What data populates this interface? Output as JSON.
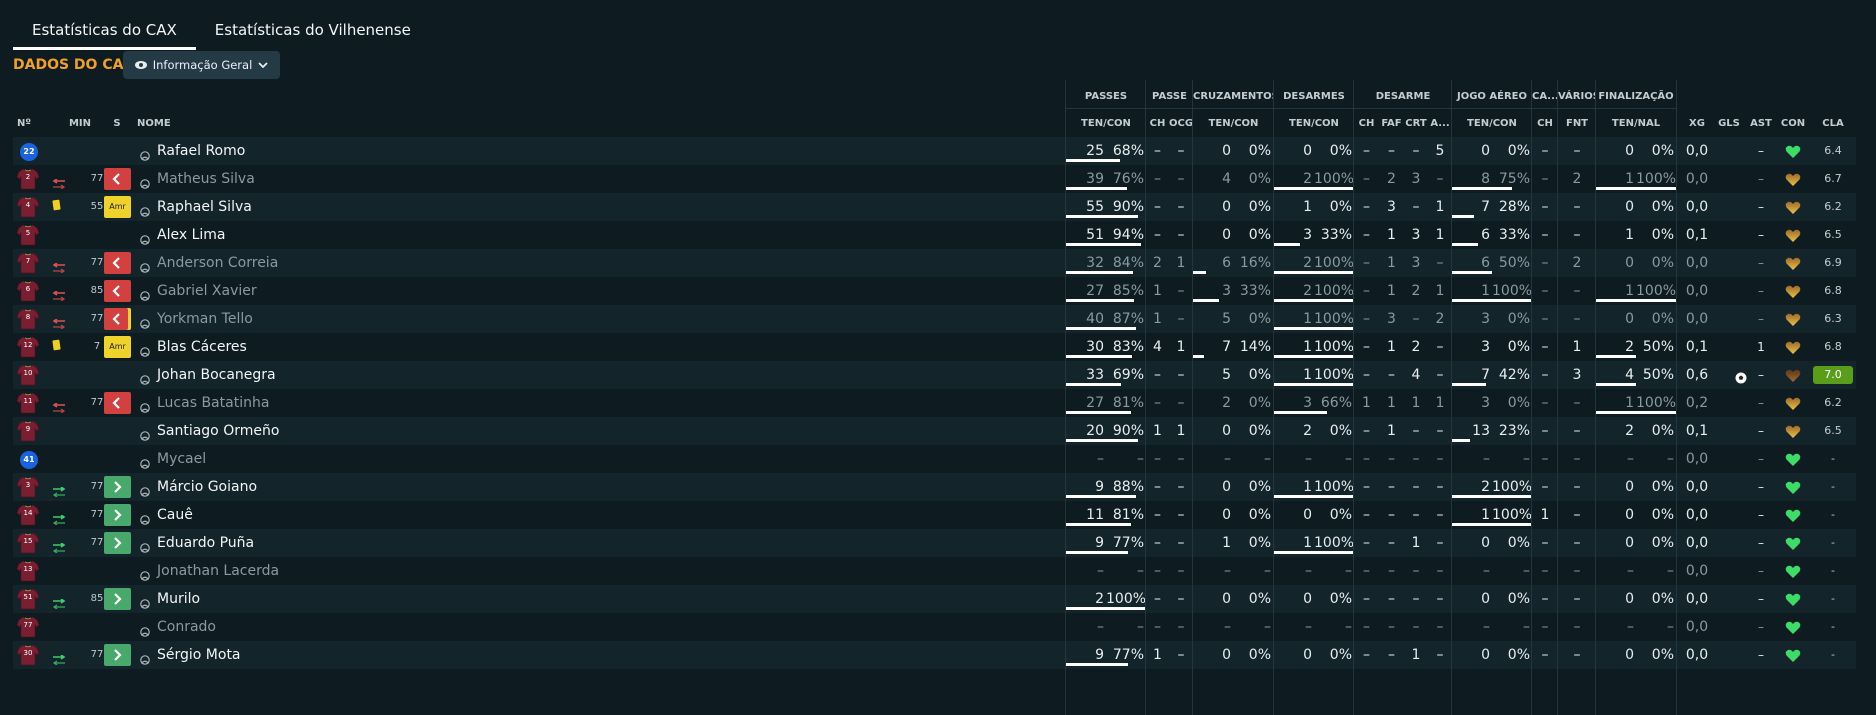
{
  "tabs": [
    {
      "label": "Estatísticas do CAX",
      "active": true
    },
    {
      "label": "Estatísticas do Vilhenense",
      "active": false
    }
  ],
  "section_title": "DADOS DO CAX",
  "view_selector": {
    "label": "Informação Geral",
    "icon": "eye-icon"
  },
  "colors": {
    "accent": "#f0a025",
    "green": "#49a86b",
    "red": "#d24040",
    "yellow": "#efd22a",
    "best_rating": "#5a9d1a"
  },
  "group_headers": {
    "passes": "PASSES",
    "passe": "PASSE",
    "cruzamentos": "CRUZAMENTOS",
    "desarmes": "DESARMES",
    "desarme": "DESARME",
    "jogo_aereo": "JOGO AÉREO",
    "ca": "CA...",
    "varios": "VÁRIOS",
    "finalizacao": "FINALIZAÇÃO"
  },
  "column_headers": {
    "num": "Nº",
    "min": "MIN",
    "s": "S",
    "nome": "NOME",
    "passes": "TEN/CON",
    "passe_ch": "CH",
    "passe_ocg": "OCG",
    "cruz": "TEN/CON",
    "des": "TEN/CON",
    "d_ch": "CH",
    "d_faf": "FAF",
    "d_crt": "CRT",
    "d_a": "A...",
    "aereo": "TEN/CON",
    "ca_ch": "CH",
    "fnt": "FNT",
    "fin": "TEN/NAL",
    "xg": "XG",
    "gls": "GLS",
    "ast": "AST",
    "con": "CON",
    "cla": "CLA"
  },
  "players": [
    {
      "num": "22",
      "kit": "gk",
      "min": "",
      "sub": "",
      "card": "",
      "s": "",
      "name": "Rafael Romo",
      "dim": false,
      "p_ten": "25",
      "p_pct": "68%",
      "p_bar": 0.68,
      "pch": "–",
      "pocg": "–",
      "c_ten": "0",
      "c_pct": "0%",
      "c_bar": 0,
      "d_ten": "0",
      "d_pct": "0%",
      "d_bar": 0,
      "dch": "–",
      "dfaf": "–",
      "dcrt": "–",
      "da": "5",
      "a_ten": "0",
      "a_pct": "0%",
      "a_bar": 0,
      "cach": "–",
      "fnt": "–",
      "f_ten": "0",
      "f_pct": "0%",
      "f_bar": 0,
      "xg": "0,0",
      "gls": "",
      "ast": "–",
      "con": "green",
      "cla": "6.4",
      "best": false
    },
    {
      "num": "2",
      "kit": "out",
      "min": "77",
      "sub": "out",
      "card": "",
      "s": "red",
      "name": "Matheus Silva",
      "dim": true,
      "p_ten": "39",
      "p_pct": "76%",
      "p_bar": 0.76,
      "pch": "–",
      "pocg": "–",
      "c_ten": "4",
      "c_pct": "0%",
      "c_bar": 0,
      "d_ten": "2",
      "d_pct": "100%",
      "d_bar": 1,
      "dch": "–",
      "dfaf": "2",
      "dcrt": "3",
      "da": "–",
      "a_ten": "8",
      "a_pct": "75%",
      "a_bar": 0.75,
      "cach": "–",
      "fnt": "2",
      "f_ten": "1",
      "f_pct": "100%",
      "f_bar": 1,
      "xg": "0,0",
      "gls": "",
      "ast": "–",
      "con": "yellow",
      "cla": "6.7",
      "best": false
    },
    {
      "num": "4",
      "kit": "out",
      "min": "55",
      "sub": "",
      "card": "yellow",
      "s": "amr",
      "name": "Raphael Silva",
      "dim": false,
      "p_ten": "55",
      "p_pct": "90%",
      "p_bar": 0.9,
      "pch": "–",
      "pocg": "–",
      "c_ten": "0",
      "c_pct": "0%",
      "c_bar": 0,
      "d_ten": "1",
      "d_pct": "0%",
      "d_bar": 0,
      "dch": "–",
      "dfaf": "3",
      "dcrt": "–",
      "da": "1",
      "a_ten": "7",
      "a_pct": "28%",
      "a_bar": 0.28,
      "cach": "–",
      "fnt": "–",
      "f_ten": "0",
      "f_pct": "0%",
      "f_bar": 0,
      "xg": "0,0",
      "gls": "",
      "ast": "–",
      "con": "yellow",
      "cla": "6.2",
      "best": false
    },
    {
      "num": "5",
      "kit": "out",
      "min": "",
      "sub": "",
      "card": "",
      "s": "",
      "name": "Alex Lima",
      "dim": false,
      "p_ten": "51",
      "p_pct": "94%",
      "p_bar": 0.94,
      "pch": "–",
      "pocg": "–",
      "c_ten": "0",
      "c_pct": "0%",
      "c_bar": 0,
      "d_ten": "3",
      "d_pct": "33%",
      "d_bar": 0.33,
      "dch": "–",
      "dfaf": "1",
      "dcrt": "3",
      "da": "1",
      "a_ten": "6",
      "a_pct": "33%",
      "a_bar": 0.33,
      "cach": "–",
      "fnt": "–",
      "f_ten": "1",
      "f_pct": "0%",
      "f_bar": 0,
      "xg": "0,1",
      "gls": "",
      "ast": "–",
      "con": "yellow",
      "cla": "6.5",
      "best": false
    },
    {
      "num": "7",
      "kit": "out",
      "min": "77",
      "sub": "out",
      "card": "",
      "s": "red",
      "name": "Anderson Correia",
      "dim": true,
      "p_ten": "32",
      "p_pct": "84%",
      "p_bar": 0.84,
      "pch": "2",
      "pocg": "1",
      "c_ten": "6",
      "c_pct": "16%",
      "c_bar": 0.16,
      "d_ten": "2",
      "d_pct": "100%",
      "d_bar": 1,
      "dch": "–",
      "dfaf": "1",
      "dcrt": "3",
      "da": "–",
      "a_ten": "6",
      "a_pct": "50%",
      "a_bar": 0.5,
      "cach": "–",
      "fnt": "2",
      "f_ten": "0",
      "f_pct": "0%",
      "f_bar": 0,
      "xg": "0,0",
      "gls": "",
      "ast": "–",
      "con": "yellow",
      "cla": "6.9",
      "best": false
    },
    {
      "num": "6",
      "kit": "out",
      "min": "85",
      "sub": "out",
      "card": "",
      "s": "red",
      "name": "Gabriel Xavier",
      "dim": true,
      "p_ten": "27",
      "p_pct": "85%",
      "p_bar": 0.85,
      "pch": "1",
      "pocg": "–",
      "c_ten": "3",
      "c_pct": "33%",
      "c_bar": 0.33,
      "d_ten": "2",
      "d_pct": "100%",
      "d_bar": 1,
      "dch": "–",
      "dfaf": "1",
      "dcrt": "2",
      "da": "1",
      "a_ten": "1",
      "a_pct": "100%",
      "a_bar": 1,
      "cach": "–",
      "fnt": "–",
      "f_ten": "1",
      "f_pct": "100%",
      "f_bar": 1,
      "xg": "0,0",
      "gls": "",
      "ast": "–",
      "con": "yellow",
      "cla": "6.8",
      "best": false
    },
    {
      "num": "8",
      "kit": "out",
      "min": "77",
      "sub": "out",
      "card": "yellow",
      "s": "red",
      "name": "Yorkman Tello",
      "dim": true,
      "p_ten": "40",
      "p_pct": "87%",
      "p_bar": 0.87,
      "pch": "1",
      "pocg": "–",
      "c_ten": "5",
      "c_pct": "0%",
      "c_bar": 0,
      "d_ten": "1",
      "d_pct": "100%",
      "d_bar": 1,
      "dch": "–",
      "dfaf": "3",
      "dcrt": "–",
      "da": "2",
      "a_ten": "3",
      "a_pct": "0%",
      "a_bar": 0,
      "cach": "–",
      "fnt": "–",
      "f_ten": "0",
      "f_pct": "0%",
      "f_bar": 0,
      "xg": "0,0",
      "gls": "",
      "ast": "–",
      "con": "yellow",
      "cla": "6.3",
      "best": false
    },
    {
      "num": "12",
      "kit": "out",
      "min": "7",
      "sub": "",
      "card": "yellow",
      "s": "amr",
      "name": "Blas Cáceres",
      "dim": false,
      "p_ten": "30",
      "p_pct": "83%",
      "p_bar": 0.83,
      "pch": "4",
      "pocg": "1",
      "c_ten": "7",
      "c_pct": "14%",
      "c_bar": 0.14,
      "d_ten": "1",
      "d_pct": "100%",
      "d_bar": 1,
      "dch": "–",
      "dfaf": "1",
      "dcrt": "2",
      "da": "–",
      "a_ten": "3",
      "a_pct": "0%",
      "a_bar": 0,
      "cach": "–",
      "fnt": "1",
      "f_ten": "2",
      "f_pct": "50%",
      "f_bar": 0.5,
      "xg": "0,1",
      "gls": "",
      "ast": "1",
      "con": "yellow",
      "cla": "6.8",
      "best": false
    },
    {
      "num": "10",
      "kit": "out",
      "min": "",
      "sub": "",
      "card": "",
      "s": "",
      "name": "Johan Bocanegra",
      "dim": false,
      "p_ten": "33",
      "p_pct": "69%",
      "p_bar": 0.69,
      "pch": "–",
      "pocg": "–",
      "c_ten": "5",
      "c_pct": "0%",
      "c_bar": 0,
      "d_ten": "1",
      "d_pct": "100%",
      "d_bar": 1,
      "dch": "–",
      "dfaf": "–",
      "dcrt": "4",
      "da": "–",
      "a_ten": "7",
      "a_pct": "42%",
      "a_bar": 0.42,
      "cach": "–",
      "fnt": "3",
      "f_ten": "4",
      "f_pct": "50%",
      "f_bar": 0.5,
      "xg": "0,6",
      "gls": "ball",
      "ast": "–",
      "con": "brown",
      "cla": "7.0",
      "best": true
    },
    {
      "num": "11",
      "kit": "out",
      "min": "77",
      "sub": "out",
      "card": "",
      "s": "red",
      "name": "Lucas Batatinha",
      "dim": true,
      "p_ten": "27",
      "p_pct": "81%",
      "p_bar": 0.81,
      "pch": "–",
      "pocg": "–",
      "c_ten": "2",
      "c_pct": "0%",
      "c_bar": 0,
      "d_ten": "3",
      "d_pct": "66%",
      "d_bar": 0.66,
      "dch": "1",
      "dfaf": "1",
      "dcrt": "1",
      "da": "1",
      "a_ten": "3",
      "a_pct": "0%",
      "a_bar": 0,
      "cach": "–",
      "fnt": "–",
      "f_ten": "1",
      "f_pct": "100%",
      "f_bar": 1,
      "xg": "0,2",
      "gls": "",
      "ast": "–",
      "con": "yellow",
      "cla": "6.2",
      "best": false
    },
    {
      "num": "9",
      "kit": "out",
      "min": "",
      "sub": "",
      "card": "",
      "s": "",
      "name": "Santiago Ormeño",
      "dim": false,
      "p_ten": "20",
      "p_pct": "90%",
      "p_bar": 0.9,
      "pch": "1",
      "pocg": "1",
      "c_ten": "0",
      "c_pct": "0%",
      "c_bar": 0,
      "d_ten": "2",
      "d_pct": "0%",
      "d_bar": 0,
      "dch": "–",
      "dfaf": "1",
      "dcrt": "–",
      "da": "–",
      "a_ten": "13",
      "a_pct": "23%",
      "a_bar": 0.23,
      "cach": "–",
      "fnt": "–",
      "f_ten": "2",
      "f_pct": "0%",
      "f_bar": 0,
      "xg": "0,1",
      "gls": "",
      "ast": "–",
      "con": "yellow",
      "cla": "6.5",
      "best": false
    },
    {
      "num": "41",
      "kit": "gk",
      "min": "",
      "sub": "",
      "card": "",
      "s": "",
      "name": "Mycael",
      "dim": true,
      "p_ten": "–",
      "p_pct": "–",
      "p_bar": 0,
      "pch": "–",
      "pocg": "–",
      "c_ten": "–",
      "c_pct": "–",
      "c_bar": 0,
      "d_ten": "–",
      "d_pct": "–",
      "d_bar": 0,
      "dch": "–",
      "dfaf": "–",
      "dcrt": "–",
      "da": "–",
      "a_ten": "–",
      "a_pct": "–",
      "a_bar": 0,
      "cach": "–",
      "fnt": "–",
      "f_ten": "–",
      "f_pct": "–",
      "f_bar": 0,
      "xg": "0,0",
      "gls": "",
      "ast": "–",
      "con": "green",
      "cla": "-",
      "best": false
    },
    {
      "num": "3",
      "kit": "out",
      "min": "77",
      "sub": "in",
      "card": "",
      "s": "green",
      "name": "Márcio Goiano",
      "dim": false,
      "p_ten": "9",
      "p_pct": "88%",
      "p_bar": 0.88,
      "pch": "–",
      "pocg": "–",
      "c_ten": "0",
      "c_pct": "0%",
      "c_bar": 0,
      "d_ten": "1",
      "d_pct": "100%",
      "d_bar": 1,
      "dch": "–",
      "dfaf": "–",
      "dcrt": "–",
      "da": "–",
      "a_ten": "2",
      "a_pct": "100%",
      "a_bar": 1,
      "cach": "–",
      "fnt": "–",
      "f_ten": "0",
      "f_pct": "0%",
      "f_bar": 0,
      "xg": "0,0",
      "gls": "",
      "ast": "–",
      "con": "green",
      "cla": "-",
      "best": false
    },
    {
      "num": "14",
      "kit": "out",
      "min": "77",
      "sub": "in",
      "card": "",
      "s": "green",
      "name": "Cauê",
      "dim": false,
      "p_ten": "11",
      "p_pct": "81%",
      "p_bar": 0.81,
      "pch": "–",
      "pocg": "–",
      "c_ten": "0",
      "c_pct": "0%",
      "c_bar": 0,
      "d_ten": "0",
      "d_pct": "0%",
      "d_bar": 0,
      "dch": "–",
      "dfaf": "–",
      "dcrt": "–",
      "da": "–",
      "a_ten": "1",
      "a_pct": "100%",
      "a_bar": 1,
      "cach": "1",
      "fnt": "–",
      "f_ten": "0",
      "f_pct": "0%",
      "f_bar": 0,
      "xg": "0,0",
      "gls": "",
      "ast": "–",
      "con": "green",
      "cla": "-",
      "best": false
    },
    {
      "num": "15",
      "kit": "out",
      "min": "77",
      "sub": "in",
      "card": "",
      "s": "green",
      "name": "Eduardo Puña",
      "dim": false,
      "p_ten": "9",
      "p_pct": "77%",
      "p_bar": 0.77,
      "pch": "–",
      "pocg": "–",
      "c_ten": "1",
      "c_pct": "0%",
      "c_bar": 0,
      "d_ten": "1",
      "d_pct": "100%",
      "d_bar": 1,
      "dch": "–",
      "dfaf": "–",
      "dcrt": "1",
      "da": "–",
      "a_ten": "0",
      "a_pct": "0%",
      "a_bar": 0,
      "cach": "–",
      "fnt": "–",
      "f_ten": "0",
      "f_pct": "0%",
      "f_bar": 0,
      "xg": "0,0",
      "gls": "",
      "ast": "–",
      "con": "green",
      "cla": "-",
      "best": false
    },
    {
      "num": "13",
      "kit": "out",
      "min": "",
      "sub": "",
      "card": "",
      "s": "",
      "name": "Jonathan Lacerda",
      "dim": true,
      "p_ten": "–",
      "p_pct": "–",
      "p_bar": 0,
      "pch": "–",
      "pocg": "–",
      "c_ten": "–",
      "c_pct": "–",
      "c_bar": 0,
      "d_ten": "–",
      "d_pct": "–",
      "d_bar": 0,
      "dch": "–",
      "dfaf": "–",
      "dcrt": "–",
      "da": "–",
      "a_ten": "–",
      "a_pct": "–",
      "a_bar": 0,
      "cach": "–",
      "fnt": "–",
      "f_ten": "–",
      "f_pct": "–",
      "f_bar": 0,
      "xg": "0,0",
      "gls": "",
      "ast": "–",
      "con": "green",
      "cla": "-",
      "best": false
    },
    {
      "num": "51",
      "kit": "out",
      "min": "85",
      "sub": "in",
      "card": "",
      "s": "green",
      "name": "Murilo",
      "dim": false,
      "p_ten": "2",
      "p_pct": "100%",
      "p_bar": 1,
      "pch": "–",
      "pocg": "–",
      "c_ten": "0",
      "c_pct": "0%",
      "c_bar": 0,
      "d_ten": "0",
      "d_pct": "0%",
      "d_bar": 0,
      "dch": "–",
      "dfaf": "–",
      "dcrt": "–",
      "da": "–",
      "a_ten": "0",
      "a_pct": "0%",
      "a_bar": 0,
      "cach": "–",
      "fnt": "–",
      "f_ten": "0",
      "f_pct": "0%",
      "f_bar": 0,
      "xg": "0,0",
      "gls": "",
      "ast": "–",
      "con": "green",
      "cla": "-",
      "best": false
    },
    {
      "num": "77",
      "kit": "out",
      "min": "",
      "sub": "",
      "card": "",
      "s": "",
      "name": "Conrado",
      "dim": true,
      "p_ten": "–",
      "p_pct": "–",
      "p_bar": 0,
      "pch": "–",
      "pocg": "–",
      "c_ten": "–",
      "c_pct": "–",
      "c_bar": 0,
      "d_ten": "–",
      "d_pct": "–",
      "d_bar": 0,
      "dch": "–",
      "dfaf": "–",
      "dcrt": "–",
      "da": "–",
      "a_ten": "–",
      "a_pct": "–",
      "a_bar": 0,
      "cach": "–",
      "fnt": "–",
      "f_ten": "–",
      "f_pct": "–",
      "f_bar": 0,
      "xg": "0,0",
      "gls": "",
      "ast": "–",
      "con": "green",
      "cla": "-",
      "best": false
    },
    {
      "num": "30",
      "kit": "out",
      "min": "77",
      "sub": "in",
      "card": "",
      "s": "green",
      "name": "Sérgio Mota",
      "dim": false,
      "p_ten": "9",
      "p_pct": "77%",
      "p_bar": 0.77,
      "pch": "1",
      "pocg": "–",
      "c_ten": "0",
      "c_pct": "0%",
      "c_bar": 0,
      "d_ten": "0",
      "d_pct": "0%",
      "d_bar": 0,
      "dch": "–",
      "dfaf": "–",
      "dcrt": "1",
      "da": "–",
      "a_ten": "0",
      "a_pct": "0%",
      "a_bar": 0,
      "cach": "–",
      "fnt": "–",
      "f_ten": "0",
      "f_pct": "0%",
      "f_bar": 0,
      "xg": "0,0",
      "gls": "",
      "ast": "–",
      "con": "green",
      "cla": "-",
      "best": false
    }
  ]
}
